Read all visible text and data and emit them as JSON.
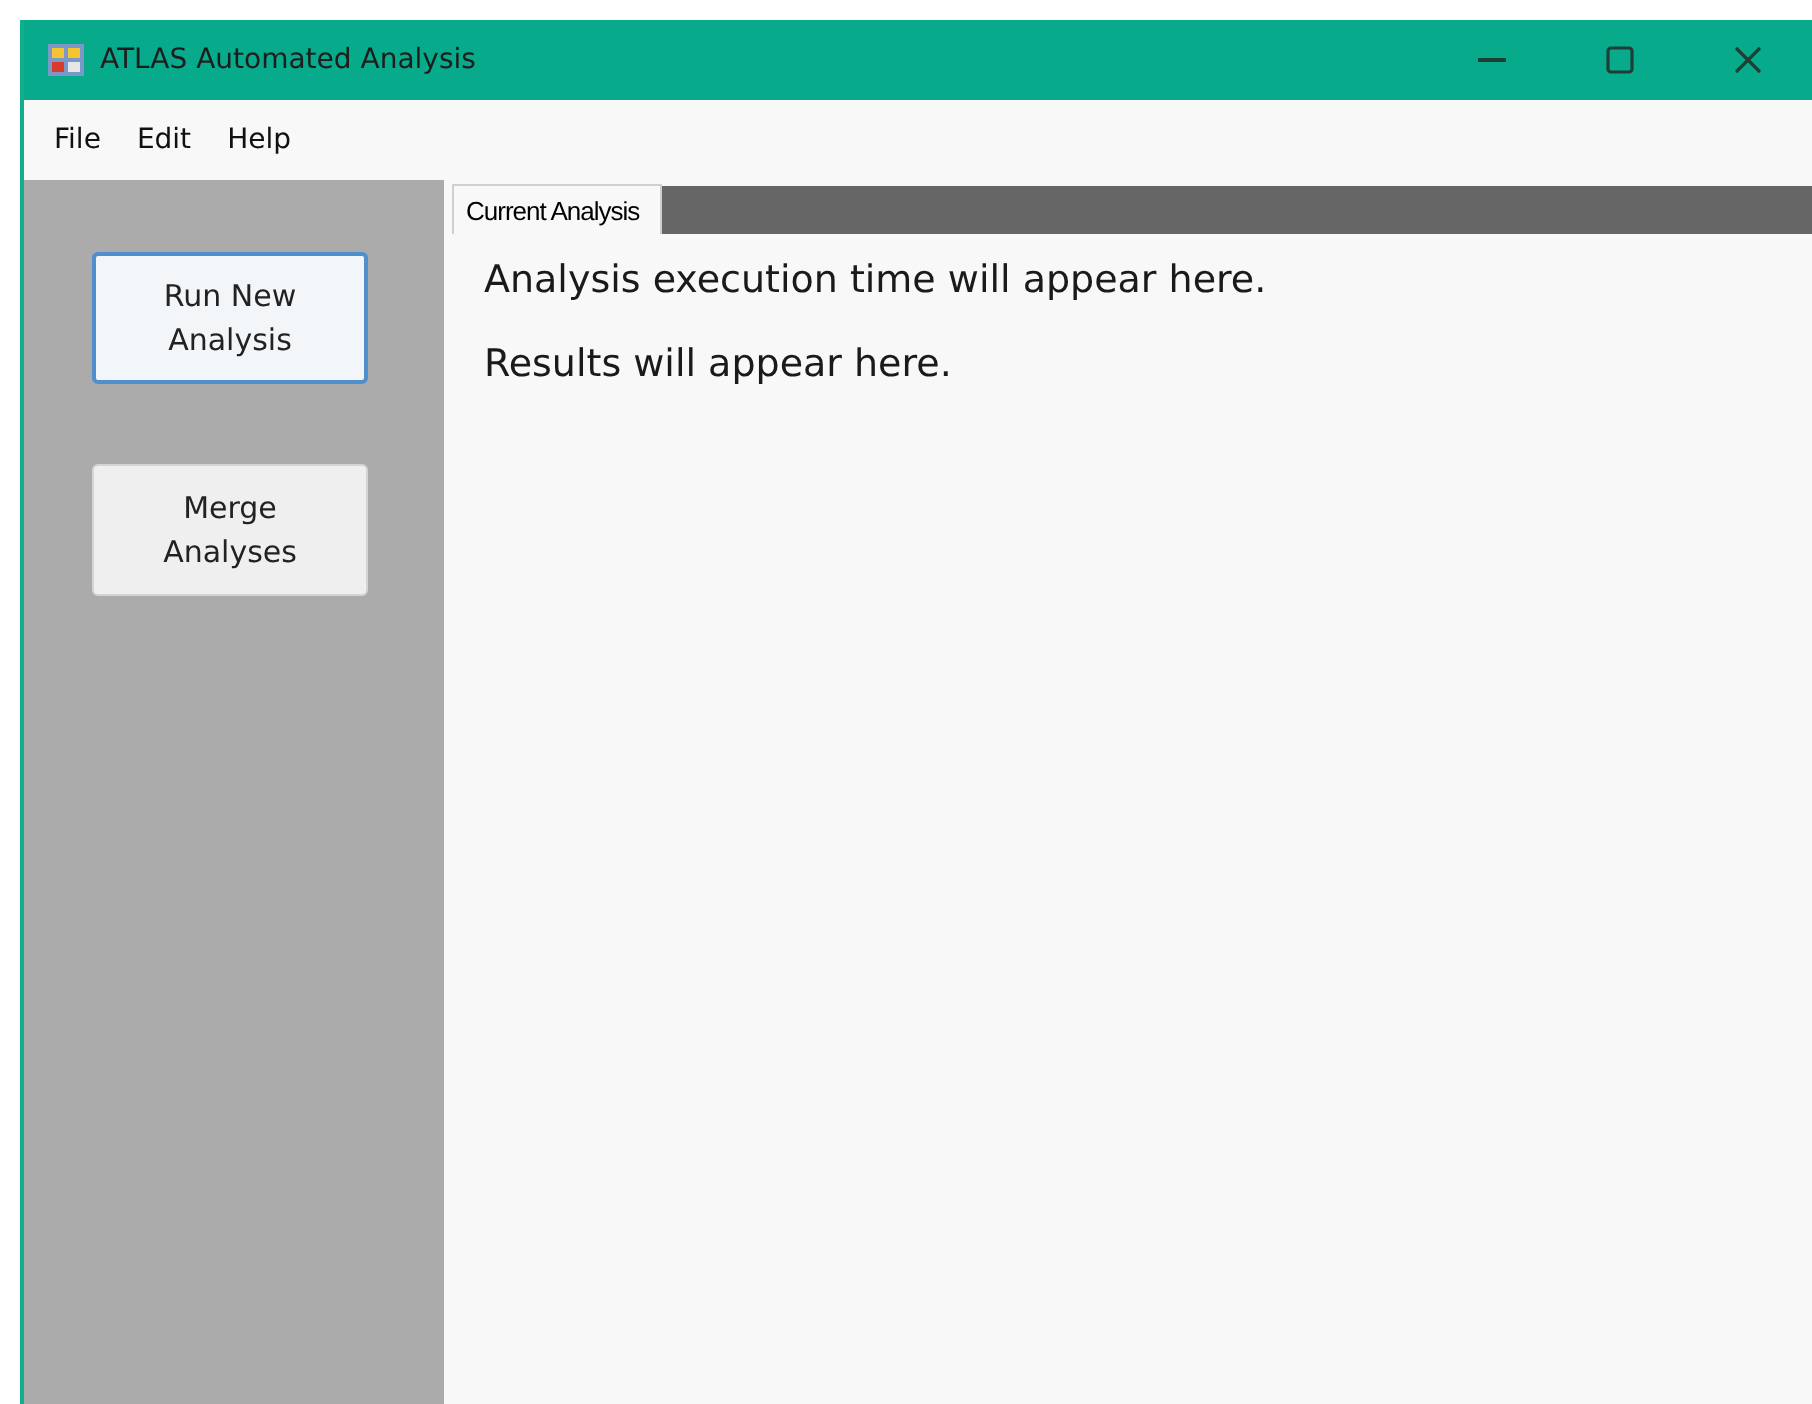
{
  "window": {
    "title": "ATLAS Automated Analysis"
  },
  "menu": [
    "File",
    "Edit",
    "Help"
  ],
  "sidebar": {
    "buttons": [
      {
        "label": "Run New Analysis",
        "focused": true
      },
      {
        "label": "Merge Analyses",
        "focused": false
      }
    ]
  },
  "tabs": [
    {
      "label": "Current Analysis",
      "selected": true
    }
  ],
  "content": {
    "lines": [
      "Analysis execution time will appear here.",
      "Results will appear here."
    ]
  }
}
